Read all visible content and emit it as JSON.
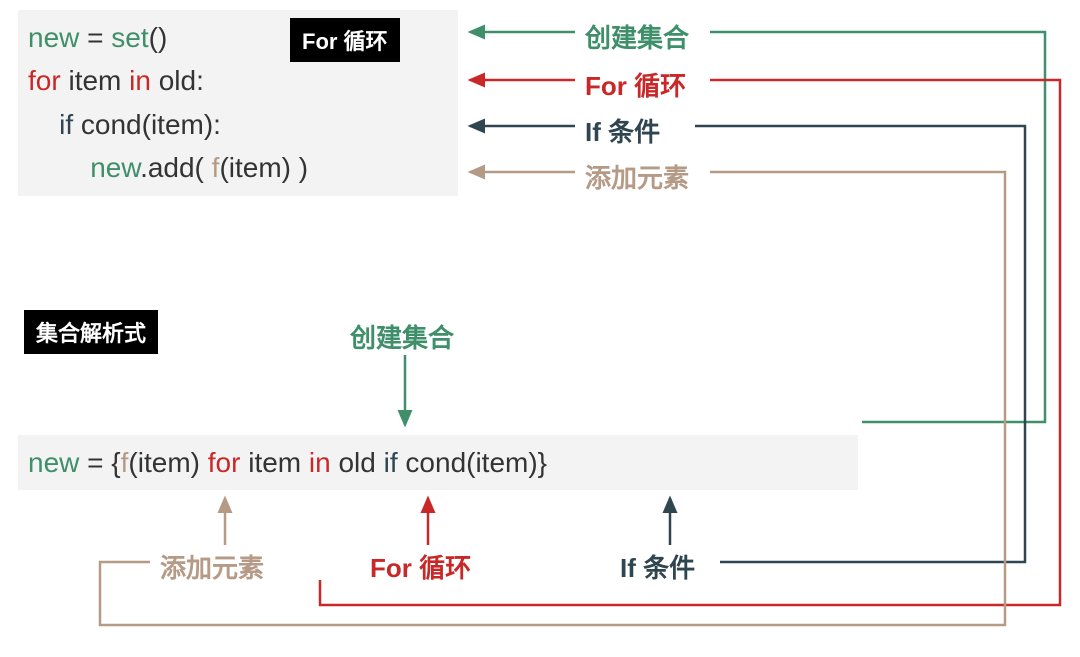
{
  "labels": {
    "for_loop_box": "For 循环",
    "set_comp_box": "集合解析式"
  },
  "annotations": {
    "create_set": "创建集合",
    "for_loop": "For 循环",
    "if_cond": "If 条件",
    "add_elem": "添加元素"
  },
  "code_top": {
    "l1": {
      "t1": "new",
      "t2": " = ",
      "t3": "set",
      "t4": "()"
    },
    "l2": {
      "t1": "for",
      "t2": " item ",
      "t3": "in",
      "t4": " old:"
    },
    "l3": {
      "t1": "    if",
      "t2": " cond(item):"
    },
    "l4": {
      "t1": "        new",
      "t2": ".add( ",
      "t3": "f",
      "t4": "(item) )"
    }
  },
  "code_bot": {
    "t1": "new",
    "t2": " = {",
    "t3": "f",
    "t4": "(item) ",
    "t5": "for",
    "t6": " item ",
    "t7": "in",
    "t8": " old ",
    "t9": "if",
    "t10": " cond(item)}"
  },
  "colors": {
    "green": "#3e8f6a",
    "red": "#c92828",
    "dark": "#2f4550",
    "tan": "#b59a86",
    "codebg": "#f3f3f3"
  }
}
